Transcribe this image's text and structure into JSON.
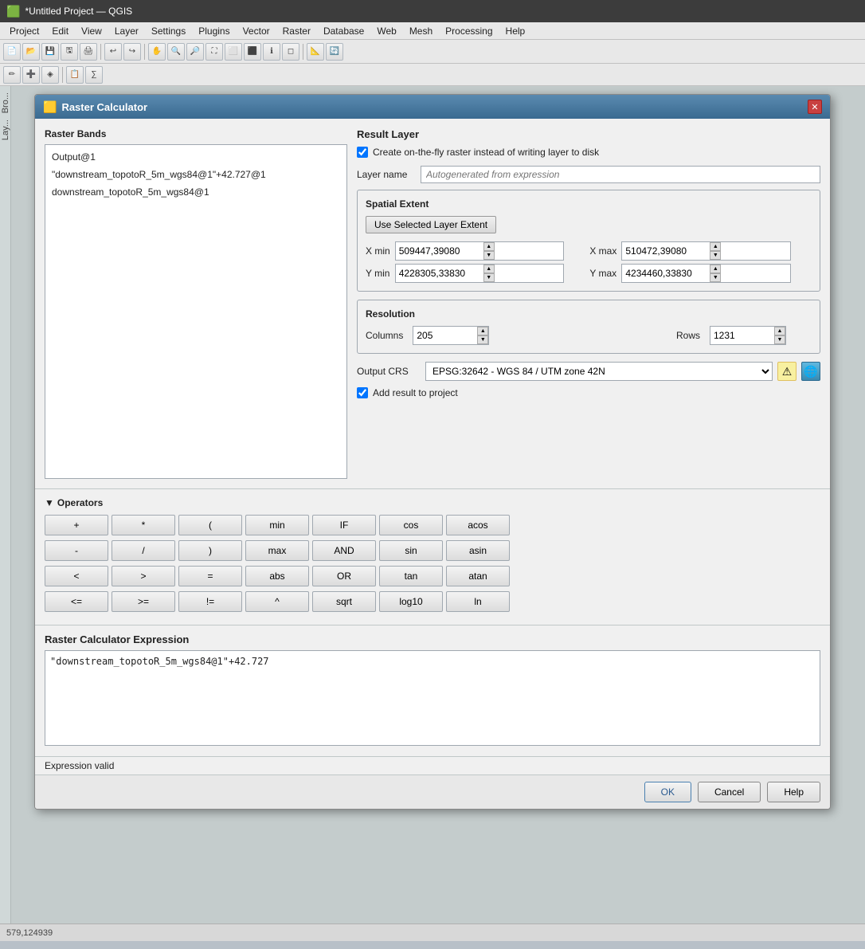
{
  "app": {
    "title": "*Untitled Project — QGIS",
    "title_icon": "⬛"
  },
  "menu": {
    "items": [
      "Project",
      "Edit",
      "View",
      "Layer",
      "Settings",
      "Plugins",
      "Vector",
      "Raster",
      "Database",
      "Web",
      "Mesh",
      "Processing",
      "Help"
    ]
  },
  "dialog": {
    "title": "Raster Calculator",
    "close_icon": "✕",
    "raster_bands": {
      "header": "Raster Bands",
      "items": [
        "Output@1",
        "\"downstream_topotoR_5m_wgs84@1\"+42.727@1",
        "downstream_topotoR_5m_wgs84@1"
      ]
    },
    "result_layer": {
      "header": "Result Layer",
      "on_the_fly_label": "Create on-the-fly raster instead of writing layer to disk",
      "on_the_fly_checked": true,
      "layer_name_label": "Layer name",
      "layer_name_placeholder": "Autogenerated from expression"
    },
    "spatial_extent": {
      "header": "Spatial Extent",
      "use_layer_btn": "Use Selected Layer Extent",
      "x_min_label": "X min",
      "x_min_value": "509447,39080",
      "x_max_label": "X max",
      "x_max_value": "510472,39080",
      "y_min_label": "Y min",
      "y_min_value": "4228305,33830",
      "y_max_label": "Y max",
      "y_max_value": "4234460,33830"
    },
    "resolution": {
      "header": "Resolution",
      "columns_label": "Columns",
      "columns_value": "205",
      "rows_label": "Rows",
      "rows_value": "1231"
    },
    "output_crs": {
      "label": "Output CRS",
      "value": "EPSG:32642 - WGS 84 / UTM zone 42N",
      "warn_icon": "⚠",
      "globe_icon": "🌐"
    },
    "add_result": {
      "label": "Add result to project",
      "checked": true
    },
    "operators": {
      "header": "Operators",
      "rows": [
        [
          "+",
          "*",
          "(",
          "min",
          "IF",
          "cos",
          "acos"
        ],
        [
          "-",
          "/",
          ")",
          "max",
          "AND",
          "sin",
          "asin"
        ],
        [
          "<",
          ">",
          "=",
          "abs",
          "OR",
          "tan",
          "atan"
        ],
        [
          "<=",
          ">=",
          "!=",
          "^",
          "sqrt",
          "log10",
          "ln"
        ]
      ]
    },
    "expression": {
      "header": "Raster Calculator Expression",
      "value": "\"downstream_topotoR_5m_wgs84@1\"+42.727"
    },
    "status": {
      "text": "Expression valid"
    },
    "footer": {
      "ok_label": "OK",
      "cancel_label": "Cancel",
      "help_label": "Help"
    }
  },
  "bottom_bar": {
    "coords": "579,124939"
  }
}
